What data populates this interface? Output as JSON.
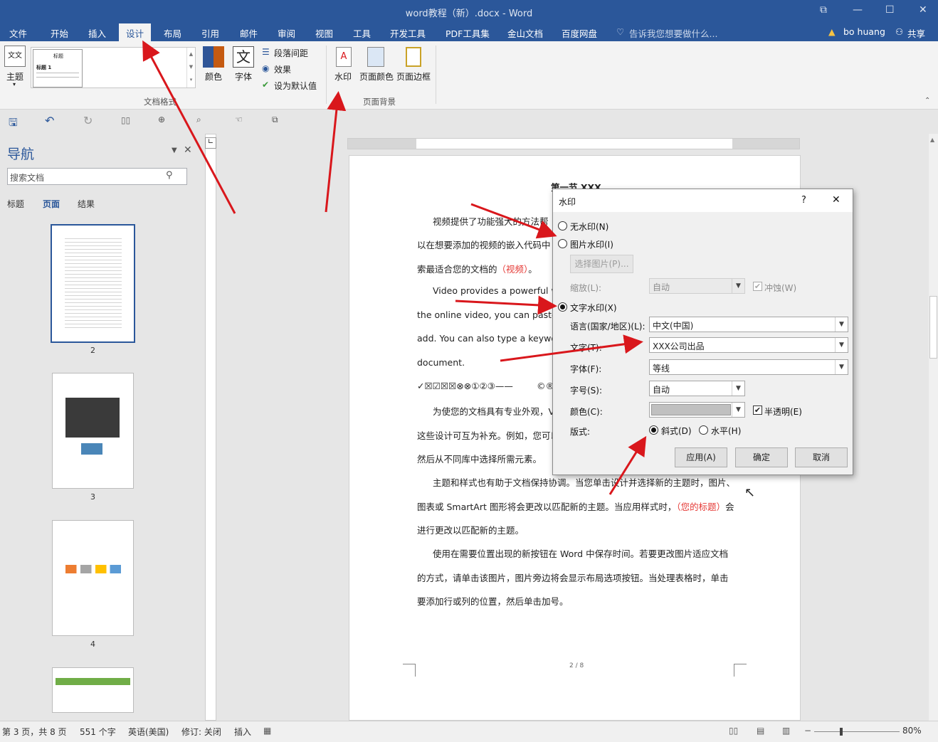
{
  "window": {
    "title": "word教程（新）.docx - Word",
    "min": "—",
    "max": "☐",
    "close": "✕",
    "restore": "⧉"
  },
  "menu": [
    "文件",
    "开始",
    "插入",
    "设计",
    "布局",
    "引用",
    "邮件",
    "审阅",
    "视图",
    "工具",
    "开发工具",
    "PDF工具集",
    "金山文档",
    "百度网盘"
  ],
  "tell_me": "告诉我您想要做什么...",
  "user": "bo huang",
  "share": "共享",
  "ribbon": {
    "theme": "主题",
    "style_title": "标题",
    "style_h1": "标题 1",
    "colors": "颜色",
    "fonts": "字体",
    "paragraph_spacing": "段落间距",
    "effects": "效果",
    "set_default": "设为默认值",
    "group_doc_format": "文档格式",
    "watermark": "水印",
    "page_color": "页面颜色",
    "page_border": "页面边框",
    "group_page_bg": "页面背景"
  },
  "nav": {
    "title": "导航",
    "search_placeholder": "搜索文档",
    "tabs": [
      "标题",
      "页面",
      "结果"
    ],
    "pages": [
      "2",
      "3",
      "4"
    ]
  },
  "document": {
    "heading": "第一节 XXX",
    "lines": [
      "视频提供了功能强大的方法帮",
      "以在想要添加的视频的嵌入代码中",
      "索最适合您的文档的",
      "Video provides a powerful way",
      "the online video, you can paste in t",
      "add. You can also type a keyword t",
      "document.",
      "✓☒☑☒☒⊗⊗①②③——",
      "为使您的文档具有专业外观，V",
      "这些设计可互为补充。例如，您可以",
      "然后从不同库中选择所需元素。",
      "主题和样式也有助于文档保持协调。当您单击设计并选择新的主题时，图片、",
      "图表或 SmartArt 图形将会更改以匹配新的主题。当应用样式时，",
      "会",
      "进行更改以匹配新的主题。",
      "使用在需要位置出现的新按钮在 Word 中保存时间。若要更改图片适应文档",
      "的方式，请单击该图片，图片旁边将会显示布局选项按钮。当处理表格时，单击",
      "要添加行或列的位置，然后单击加号。"
    ],
    "red_video": "（视频）",
    "red_title": "（您的标题）",
    "symbols_tail": "©®",
    "page_footer": "2 / 8"
  },
  "dialog": {
    "title": "水印",
    "help": "?",
    "close": "✕",
    "no_watermark": "无水印(N)",
    "picture_watermark": "图片水印(I)",
    "select_picture": "选择图片(P)...",
    "scale_label": "缩放(L):",
    "scale_value": "自动",
    "washout": "冲蚀(W)",
    "text_watermark": "文字水印(X)",
    "language_label": "语言(国家/地区)(L):",
    "language_value": "中文(中国)",
    "text_label": "文字(T):",
    "text_value": "XXX公司出品",
    "font_label": "字体(F):",
    "font_value": "等线",
    "size_label": "字号(S):",
    "size_value": "自动",
    "color_label": "颜色(C):",
    "semitransparent": "半透明(E)",
    "layout_label": "版式:",
    "diagonal": "斜式(D)",
    "horizontal": "水平(H)",
    "apply": "应用(A)",
    "ok": "确定",
    "cancel": "取消",
    "selected_mode": "text",
    "selected_layout": "diagonal"
  },
  "status": {
    "page": "第 3 页，共 8 页",
    "words": "551 个字",
    "lang": "英语(美国)",
    "track": "修订: 关闭",
    "insert": "插入",
    "zoom": "80%"
  },
  "colors": {
    "brand": "#2b579a",
    "arrow": "#d9171c"
  }
}
